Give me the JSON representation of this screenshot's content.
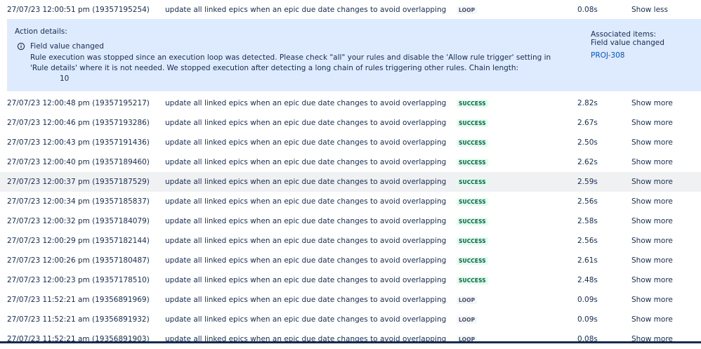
{
  "expanded_row": {
    "date": "27/07/23 12:00:51 pm (19357195254)",
    "rule": "update all linked epics when an epic due date changes to avoid overlapping",
    "status": "LOOP",
    "duration": "0.08s",
    "action": "Show less"
  },
  "details": {
    "title": "Action details:",
    "info_icon": "info-icon",
    "field": "Field value changed",
    "message": "Rule execution was stopped since an execution loop was detected. Please check \"all\" your rules and disable the 'Allow rule trigger' setting in 'Rule details' where it is not needed. We stopped execution after detecting a long chain of rules triggering other rules. Chain length:",
    "chain_length": "10",
    "associated_title": "Associated items:",
    "associated_sub": "Field value changed",
    "associated_link": "PROJ-308"
  },
  "rows": [
    {
      "date": "27/07/23 12:00:48 pm (19357195217)",
      "rule": "update all linked epics when an epic due date changes to avoid overlapping",
      "status": "SUCCESS",
      "duration": "2.82s",
      "action": "Show more"
    },
    {
      "date": "27/07/23 12:00:46 pm (19357193286)",
      "rule": "update all linked epics when an epic due date changes to avoid overlapping",
      "status": "SUCCESS",
      "duration": "2.67s",
      "action": "Show more"
    },
    {
      "date": "27/07/23 12:00:43 pm (19357191436)",
      "rule": "update all linked epics when an epic due date changes to avoid overlapping",
      "status": "SUCCESS",
      "duration": "2.50s",
      "action": "Show more"
    },
    {
      "date": "27/07/23 12:00:40 pm (19357189460)",
      "rule": "update all linked epics when an epic due date changes to avoid overlapping",
      "status": "SUCCESS",
      "duration": "2.62s",
      "action": "Show more"
    },
    {
      "date": "27/07/23 12:00:37 pm (19357187529)",
      "rule": "update all linked epics when an epic due date changes to avoid overlapping",
      "status": "SUCCESS",
      "duration": "2.59s",
      "action": "Show more"
    },
    {
      "date": "27/07/23 12:00:34 pm (19357185837)",
      "rule": "update all linked epics when an epic due date changes to avoid overlapping",
      "status": "SUCCESS",
      "duration": "2.56s",
      "action": "Show more"
    },
    {
      "date": "27/07/23 12:00:32 pm (19357184079)",
      "rule": "update all linked epics when an epic due date changes to avoid overlapping",
      "status": "SUCCESS",
      "duration": "2.58s",
      "action": "Show more"
    },
    {
      "date": "27/07/23 12:00:29 pm (19357182144)",
      "rule": "update all linked epics when an epic due date changes to avoid overlapping",
      "status": "SUCCESS",
      "duration": "2.56s",
      "action": "Show more"
    },
    {
      "date": "27/07/23 12:00:26 pm (19357180487)",
      "rule": "update all linked epics when an epic due date changes to avoid overlapping",
      "status": "SUCCESS",
      "duration": "2.61s",
      "action": "Show more"
    },
    {
      "date": "27/07/23 12:00:23 pm (19357178510)",
      "rule": "update all linked epics when an epic due date changes to avoid overlapping",
      "status": "SUCCESS",
      "duration": "2.48s",
      "action": "Show more"
    },
    {
      "date": "27/07/23 11:52:21 am (19356891969)",
      "rule": "update all linked epics when an epic due date changes to avoid overlapping",
      "status": "LOOP",
      "duration": "0.09s",
      "action": "Show more"
    },
    {
      "date": "27/07/23 11:52:21 am (19356891932)",
      "rule": "update all linked epics when an epic due date changes to avoid overlapping",
      "status": "LOOP",
      "duration": "0.09s",
      "action": "Show more"
    },
    {
      "date": "27/07/23 11:52:21 am (19356891903)",
      "rule": "update all linked epics when an epic due date changes to avoid overlapping",
      "status": "LOOP",
      "duration": "0.08s",
      "action": "Show more"
    }
  ],
  "colors": {
    "success_bg": "#e3fcef",
    "success_text": "#006644",
    "loop_bg": "#f4f5f7",
    "loop_text": "#42526e",
    "details_bg": "#deebff",
    "link": "#0052cc"
  }
}
